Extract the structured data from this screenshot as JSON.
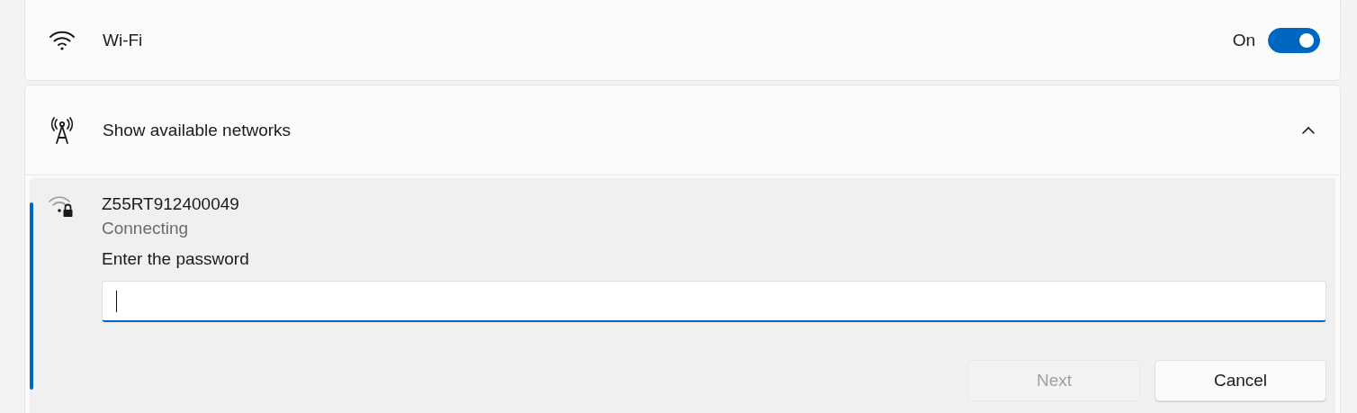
{
  "wifi": {
    "label": "Wi-Fi",
    "state_label": "On",
    "on": true
  },
  "networks_section": {
    "label": "Show available networks",
    "expanded": true
  },
  "network": {
    "name": "Z55RT912400049",
    "status": "Connecting",
    "selected": true,
    "password_label": "Enter the password",
    "buttons": [
      {
        "label": "Next",
        "disabled": true
      },
      {
        "label": "Cancel",
        "disabled": false
      }
    ]
  }
}
